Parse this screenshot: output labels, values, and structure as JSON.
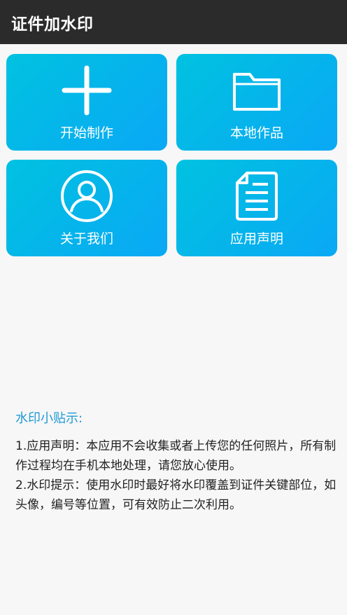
{
  "app_bar": {
    "title": "证件加水印"
  },
  "cards": [
    {
      "id": "start",
      "label": "开始制作",
      "icon": "plus-icon"
    },
    {
      "id": "works",
      "label": "本地作品",
      "icon": "folder-icon"
    },
    {
      "id": "about",
      "label": "关于我们",
      "icon": "user-circle-icon"
    },
    {
      "id": "statement",
      "label": "应用声明",
      "icon": "document-icon"
    }
  ],
  "tips": {
    "title": "水印小贴示:",
    "items": [
      "1.应用声明：本应用不会收集或者上传您的任何照片，所有制作过程均在手机本地处理，请您放心使用。",
      "2.水印提示：使用水印时最好将水印覆盖到证件关键部位，如头像，编号等位置，可有效防止二次利用。"
    ]
  },
  "colors": {
    "app_bar_bg": "#2b2b2b",
    "card_gradient_start": "#00c2e0",
    "card_gradient_end": "#0aa8f5",
    "tips_title": "#1f9ad6",
    "background": "#f7f7f7"
  }
}
